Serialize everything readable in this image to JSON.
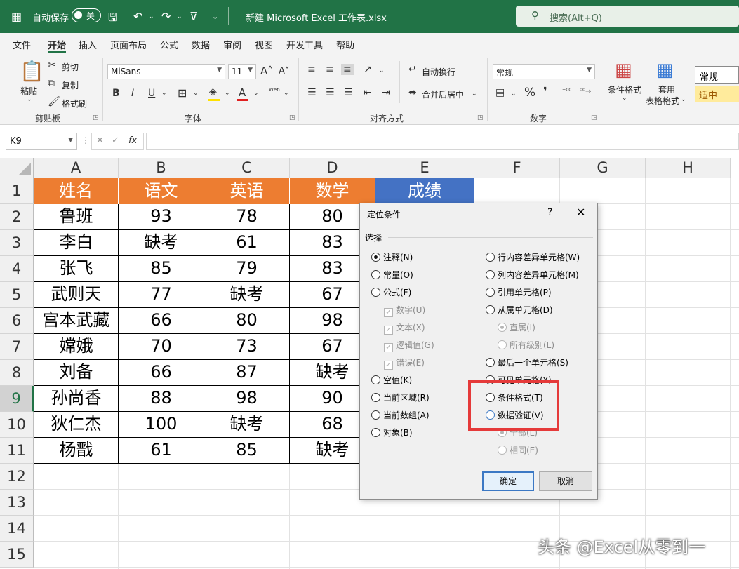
{
  "titlebar": {
    "autosave_label": "自动保存",
    "autosave_state": "关",
    "doc_title": "新建 Microsoft Excel 工作表.xlsx",
    "search_placeholder": "搜索(Alt+Q)"
  },
  "menu": {
    "tabs": [
      "文件",
      "开始",
      "插入",
      "页面布局",
      "公式",
      "数据",
      "审阅",
      "视图",
      "开发工具",
      "帮助"
    ],
    "active": "开始"
  },
  "ribbon": {
    "clipboard": {
      "paste": "粘贴",
      "cut": "剪切",
      "copy": "复制",
      "format_painter": "格式刷",
      "label": "剪贴板"
    },
    "font": {
      "name": "MiSans",
      "size": "11",
      "label": "字体"
    },
    "alignment": {
      "wrap": "自动换行",
      "merge": "合并后居中",
      "label": "对齐方式"
    },
    "number": {
      "format": "常规",
      "label": "数字"
    },
    "styles": {
      "conditional": "条件格式",
      "table_line1": "套用",
      "table_line2": "表格格式",
      "normal": "常规",
      "neutral": "适中"
    }
  },
  "formula_bar": {
    "name_box": "K9",
    "fx": "fx",
    "value": ""
  },
  "sheet": {
    "columns": [
      "A",
      "B",
      "C",
      "D",
      "E",
      "F",
      "G",
      "H"
    ],
    "rows": [
      "1",
      "2",
      "3",
      "4",
      "5",
      "6",
      "7",
      "8",
      "9",
      "10",
      "11",
      "12",
      "13",
      "14",
      "15"
    ],
    "selected_row": "9",
    "header": [
      "姓名",
      "语文",
      "英语",
      "数学",
      "成绩"
    ],
    "data": [
      [
        "鲁班",
        "93",
        "78",
        "80"
      ],
      [
        "李白",
        "缺考",
        "61",
        "83"
      ],
      [
        "张飞",
        "85",
        "79",
        "83"
      ],
      [
        "武则天",
        "77",
        "缺考",
        "67"
      ],
      [
        "宫本武藏",
        "66",
        "80",
        "98"
      ],
      [
        "嫦娥",
        "70",
        "73",
        "67"
      ],
      [
        "刘备",
        "66",
        "87",
        "缺考"
      ],
      [
        "孙尚香",
        "88",
        "98",
        "90"
      ],
      [
        "狄仁杰",
        "100",
        "缺考",
        "68"
      ],
      [
        "杨戬",
        "61",
        "85",
        "缺考"
      ]
    ]
  },
  "dialog": {
    "title": "定位条件",
    "help": "?",
    "close": "✕",
    "group": "选择",
    "left": [
      {
        "label": "注释(N)",
        "type": "radio",
        "checked": true
      },
      {
        "label": "常量(O)",
        "type": "radio"
      },
      {
        "label": "公式(F)",
        "type": "radio"
      },
      {
        "label": "数字(U)",
        "type": "check",
        "disabled": true
      },
      {
        "label": "文本(X)",
        "type": "check",
        "disabled": true
      },
      {
        "label": "逻辑值(G)",
        "type": "check",
        "disabled": true
      },
      {
        "label": "错误(E)",
        "type": "check",
        "disabled": true
      },
      {
        "label": "空值(K)",
        "type": "radio"
      },
      {
        "label": "当前区域(R)",
        "type": "radio"
      },
      {
        "label": "当前数组(A)",
        "type": "radio"
      },
      {
        "label": "对象(B)",
        "type": "radio"
      }
    ],
    "right": [
      {
        "label": "行内容差异单元格(W)",
        "type": "radio"
      },
      {
        "label": "列内容差异单元格(M)",
        "type": "radio"
      },
      {
        "label": "引用单元格(P)",
        "type": "radio"
      },
      {
        "label": "从属单元格(D)",
        "type": "radio"
      },
      {
        "label": "直属(I)",
        "type": "radio",
        "disabled": true,
        "checked": true
      },
      {
        "label": "所有级别(L)",
        "type": "radio",
        "disabled": true
      },
      {
        "label": "最后一个单元格(S)",
        "type": "radio"
      },
      {
        "label": "可见单元格(Y)",
        "type": "radio"
      },
      {
        "label": "条件格式(T)",
        "type": "radio"
      },
      {
        "label": "数据验证(V)",
        "type": "radio",
        "focus": true
      },
      {
        "label": "全部(L)",
        "type": "radio",
        "disabled": true,
        "checked": true
      },
      {
        "label": "相同(E)",
        "type": "radio",
        "disabled": true
      }
    ],
    "ok": "确定",
    "cancel": "取消"
  },
  "watermark": "头条 @Excel从零到一",
  "colors": {
    "title_green": "#217346",
    "header_orange": "#ed7d31",
    "header_blue": "#4472c4",
    "highlight_red": "#e53a3a"
  }
}
